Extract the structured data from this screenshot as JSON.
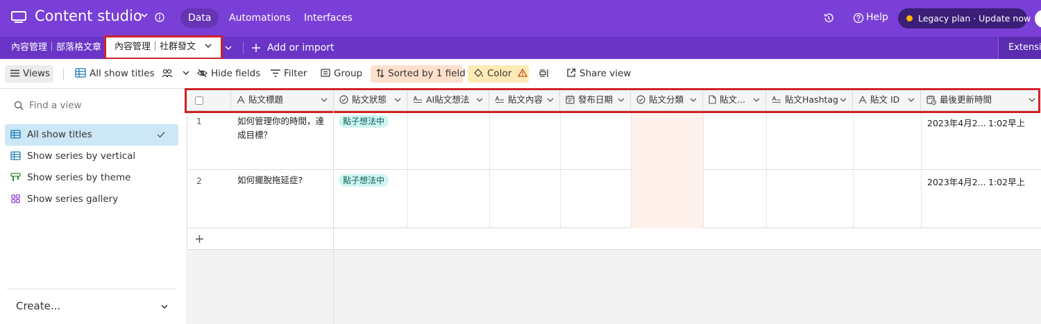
{
  "topbar": {
    "app_title": "Content studio",
    "tabs": [
      {
        "label": "Data",
        "active": true
      },
      {
        "label": "Automations",
        "active": false
      },
      {
        "label": "Interfaces",
        "active": false
      }
    ],
    "help_label": "Help",
    "legacy_button": "Legacy plan · Update now"
  },
  "table_tabs": {
    "tabs": [
      "內容管理｜部落格文章",
      "內容管理｜社群發文"
    ],
    "active_index": 1,
    "add_label": "Add or import",
    "extensions_label": "Extensions"
  },
  "toolbar": {
    "views_label": "Views",
    "current_view": "All show titles",
    "hide_fields": "Hide fields",
    "filter": "Filter",
    "group": "Group",
    "sorted": "Sorted by 1 field",
    "color": "Color",
    "share_view": "Share view"
  },
  "sidebar": {
    "find_placeholder": "Find a view",
    "views": [
      {
        "label": "All show titles",
        "type": "grid",
        "active": true
      },
      {
        "label": "Show series by vertical",
        "type": "grid",
        "active": false
      },
      {
        "label": "Show series by theme",
        "type": "kanban",
        "active": false
      },
      {
        "label": "Show series gallery",
        "type": "gallery",
        "active": false
      }
    ],
    "create_label": "Create..."
  },
  "grid": {
    "columns": [
      {
        "label": "貼文標題",
        "icon": "text-icon"
      },
      {
        "label": "貼文狀態",
        "icon": "status-icon"
      },
      {
        "label": "AI貼文想法",
        "icon": "long-text-icon"
      },
      {
        "label": "貼文內容",
        "icon": "long-text-icon"
      },
      {
        "label": "發布日期",
        "icon": "calendar-icon"
      },
      {
        "label": "貼文分類",
        "icon": "status-icon"
      },
      {
        "label": "貼文...",
        "icon": "document-icon"
      },
      {
        "label": "貼文Hashtag",
        "icon": "long-text-icon"
      },
      {
        "label": "貼文 ID",
        "icon": "text-icon"
      },
      {
        "label": "最後更新時間",
        "icon": "modified-time-icon"
      }
    ],
    "rows": [
      {
        "num": "1",
        "title": "如何管理你的時間，達成目標？",
        "status": "點子想法中",
        "updated_date": "2023年4月2...",
        "updated_time": "1:02早上"
      },
      {
        "num": "2",
        "title": "如何擺脫拖延症?",
        "status": "點子想法中",
        "updated_date": "2023年4月2...",
        "updated_time": "1:02早上"
      }
    ]
  }
}
